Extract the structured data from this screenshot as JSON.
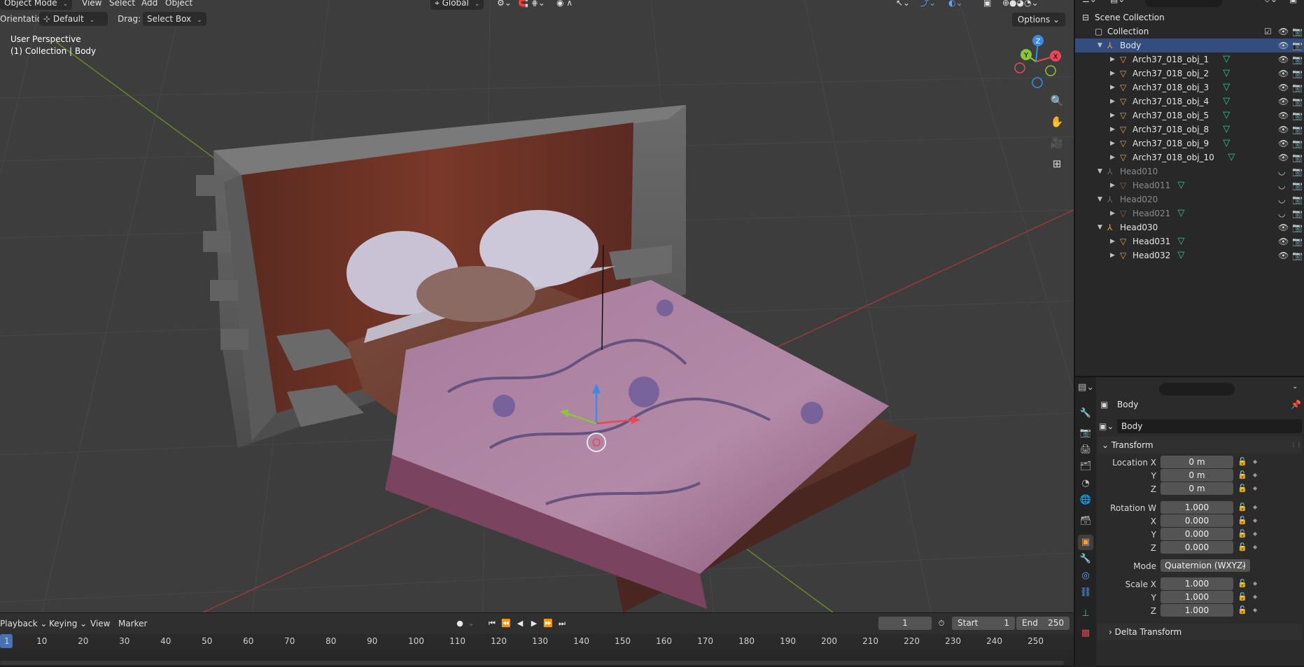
{
  "viewport_header": {
    "mode": "Object Mode",
    "menu": [
      "View",
      "Select",
      "Add",
      "Object"
    ],
    "transform_space": "Global",
    "orientation_label": "Orientation:",
    "orientation_value": "Default",
    "drag_label": "Drag:",
    "drag_value": "Select Box",
    "options": "Options"
  },
  "viewport_overlay": {
    "perspective": "User Perspective",
    "collection_info": "(1) Collection | Body"
  },
  "gizmo_axes": {
    "x": "X",
    "y": "Y",
    "z": "Z"
  },
  "timeline": {
    "menus": [
      "Playback",
      "Keying",
      "View",
      "Marker"
    ],
    "current_frame": "1",
    "start_label": "Start",
    "start_value": "1",
    "end_label": "End",
    "end_value": "250",
    "ruler": [
      "1",
      "10",
      "20",
      "30",
      "40",
      "50",
      "60",
      "70",
      "80",
      "90",
      "100",
      "110",
      "120",
      "130",
      "140",
      "150",
      "160",
      "170",
      "180",
      "190",
      "200",
      "210",
      "220",
      "230",
      "240",
      "250"
    ]
  },
  "outliner": {
    "rows": [
      {
        "label": "Scene Collection",
        "kind": "scene",
        "dim": false,
        "selected": false
      },
      {
        "label": "Collection",
        "kind": "collection",
        "dim": false,
        "selected": false
      },
      {
        "label": "Body",
        "kind": "empty",
        "dim": false,
        "selected": true
      },
      {
        "label": "Arch37_018_obj_1",
        "kind": "mesh",
        "dim": false,
        "selected": false
      },
      {
        "label": "Arch37_018_obj_2",
        "kind": "mesh",
        "dim": false,
        "selected": false
      },
      {
        "label": "Arch37_018_obj_3",
        "kind": "mesh",
        "dim": false,
        "selected": false
      },
      {
        "label": "Arch37_018_obj_4",
        "kind": "mesh",
        "dim": false,
        "selected": false
      },
      {
        "label": "Arch37_018_obj_5",
        "kind": "mesh",
        "dim": false,
        "selected": false
      },
      {
        "label": "Arch37_018_obj_8",
        "kind": "mesh",
        "dim": false,
        "selected": false
      },
      {
        "label": "Arch37_018_obj_9",
        "kind": "mesh",
        "dim": false,
        "selected": false
      },
      {
        "label": "Arch37_018_obj_10",
        "kind": "mesh",
        "dim": false,
        "selected": false
      },
      {
        "label": "Head010",
        "kind": "empty",
        "dim": true,
        "selected": false
      },
      {
        "label": "Head011",
        "kind": "mesh",
        "dim": true,
        "selected": false
      },
      {
        "label": "Head020",
        "kind": "empty",
        "dim": true,
        "selected": false
      },
      {
        "label": "Head021",
        "kind": "mesh",
        "dim": true,
        "selected": false
      },
      {
        "label": "Head030",
        "kind": "empty",
        "dim": false,
        "selected": false
      },
      {
        "label": "Head031",
        "kind": "mesh",
        "dim": false,
        "selected": false
      },
      {
        "label": "Head032",
        "kind": "mesh",
        "dim": false,
        "selected": false
      }
    ]
  },
  "properties": {
    "object_name": "Body",
    "data_name": "Body",
    "panel_transform": "Transform",
    "location": {
      "label_x": "Location X",
      "label_y": "Y",
      "label_z": "Z",
      "x": "0 m",
      "y": "0 m",
      "z": "0 m"
    },
    "rotation": {
      "label_w": "Rotation W",
      "label_x": "X",
      "label_y": "Y",
      "label_z": "Z",
      "w": "1.000",
      "x": "0.000",
      "y": "0.000",
      "z": "0.000"
    },
    "mode_label": "Mode",
    "mode_value": "Quaternion (WXYZ)",
    "scale": {
      "label_x": "Scale X",
      "label_y": "Y",
      "label_z": "Z",
      "x": "1.000",
      "y": "1.000",
      "z": "1.000"
    },
    "panel_delta": "Delta Transform"
  },
  "colors": {
    "selected_row": "#334d80",
    "active_tab": "#ff9c3a",
    "mesh_icon": "#ff9c3a",
    "mesh_data": "#33cc99",
    "axis_x": "#e8475a",
    "axis_y": "#8cc43c",
    "axis_z": "#3d8be6"
  }
}
